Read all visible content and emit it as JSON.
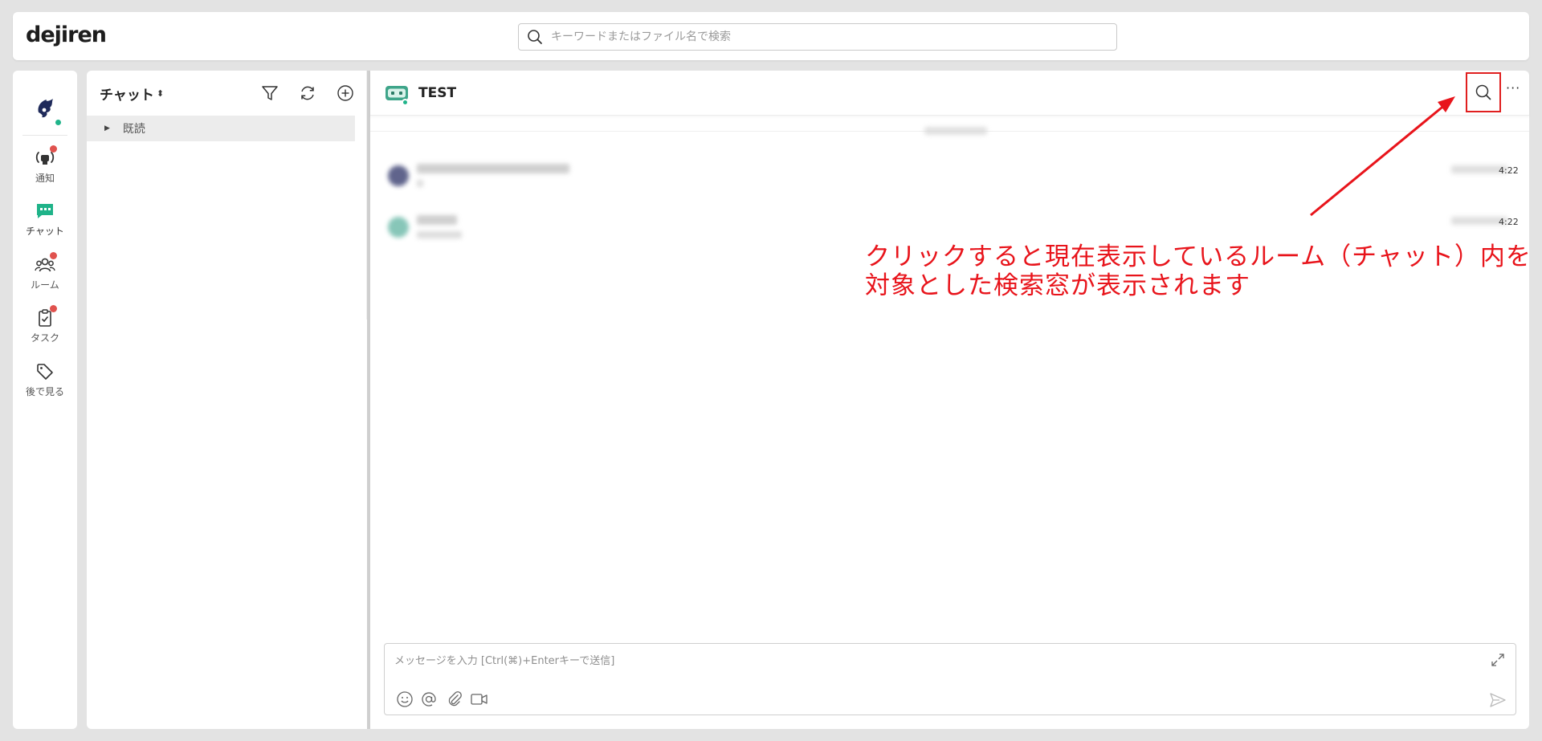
{
  "app": {
    "logo_text": "dejiren",
    "search": {
      "placeholder": "キーワードまたはファイル名で検索",
      "value": ""
    }
  },
  "colors": {
    "accent": "#20b48a",
    "badge": "#e0524e",
    "annotation": "#e8141b",
    "chat_icon": "#1fb389"
  },
  "rail": {
    "items": [
      {
        "label": "通知",
        "icon": "broadcast-icon",
        "badge": true
      },
      {
        "label": "チャット",
        "icon": "chat-icon",
        "badge": false,
        "active": true
      },
      {
        "label": "ルーム",
        "icon": "people-icon",
        "badge": true
      },
      {
        "label": "タスク",
        "icon": "clipboard-check-icon",
        "badge": true
      },
      {
        "label": "後で見る",
        "icon": "tag-icon",
        "badge": false
      }
    ]
  },
  "list": {
    "title": "チャット",
    "sort_glyph": "⬍",
    "groups": [
      {
        "label": "既読",
        "expanded": false
      }
    ]
  },
  "chat": {
    "room_title": "TEST",
    "more_glyph": "···",
    "messages": [
      {
        "time": "4:22"
      },
      {
        "time": "4:22"
      }
    ],
    "composer": {
      "placeholder": "メッセージを入力 [Ctrl(⌘)+Enterキーで送信]",
      "value": ""
    }
  },
  "annotation": {
    "lines": [
      "クリックすると現在表示しているルーム（チャット）内を",
      "対象とした検索窓が表示されます"
    ]
  }
}
